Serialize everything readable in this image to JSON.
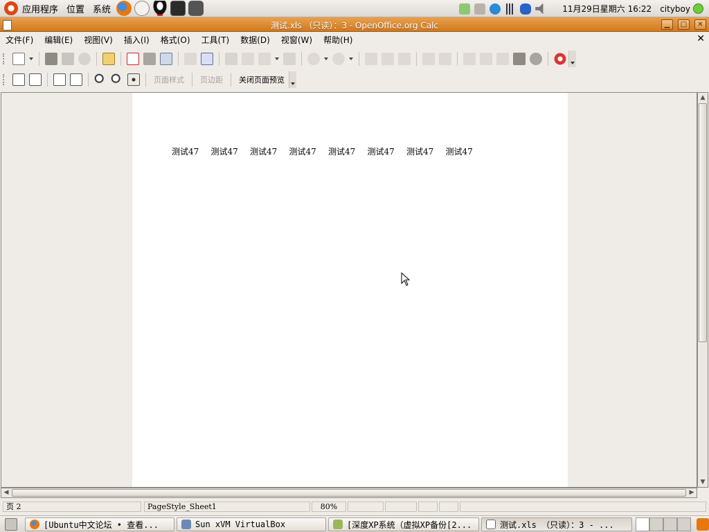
{
  "top_panel": {
    "menus": [
      "应用程序",
      "位置",
      "系统"
    ],
    "clock": "11月29日星期六 16:22",
    "user": "cityboy"
  },
  "window": {
    "title": "测试.xls （只读）：3 - OpenOffice.org Calc"
  },
  "menubar": {
    "items": [
      "文件(F)",
      "编辑(E)",
      "视图(V)",
      "插入(I)",
      "格式(O)",
      "工具(T)",
      "数据(D)",
      "视窗(W)",
      "帮助(H)"
    ]
  },
  "preview_toolbar": {
    "page_style": "页面样式",
    "margins": "页边距",
    "close_preview": "关闭页面预览"
  },
  "page": {
    "cells": [
      "测试47",
      "测试47",
      "测试47",
      "测试47",
      "测试47",
      "测试47",
      "测试47",
      "测试47"
    ]
  },
  "statusbar": {
    "page": "页 2",
    "page_style": "PageStyle_Sheet1",
    "zoom": "80%"
  },
  "taskbar": {
    "items": [
      "[Ubuntu中文论坛 • 查看...",
      "Sun xVM VirtualBox",
      "[深度XP系统（虚拟XP备份[2...",
      "测试.xls （只读）：3 - ..."
    ]
  },
  "colors": {
    "titlebar": "#d07a1e",
    "accent": "#dd4814"
  }
}
